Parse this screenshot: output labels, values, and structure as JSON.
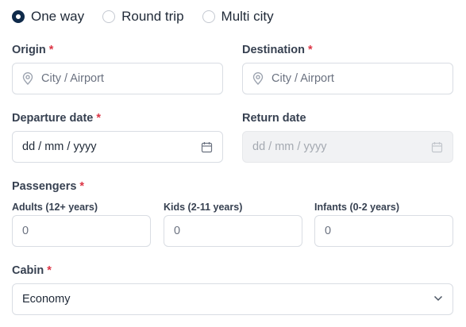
{
  "trip_type": {
    "options": [
      {
        "label": "One way",
        "checked": true
      },
      {
        "label": "Round trip",
        "checked": false
      },
      {
        "label": "Multi city",
        "checked": false
      }
    ]
  },
  "origin": {
    "label": "Origin",
    "required": "*",
    "placeholder": "City / Airport",
    "icon": "map-pin-icon"
  },
  "destination": {
    "label": "Destination",
    "required": "*",
    "placeholder": "City / Airport",
    "icon": "map-pin-icon"
  },
  "departure": {
    "label": "Departure date",
    "required": "*",
    "value": "dd / mm / yyyy",
    "icon": "calendar-icon"
  },
  "return_date": {
    "label": "Return date",
    "placeholder": "dd / mm / yyyy",
    "disabled": true,
    "icon": "calendar-icon"
  },
  "passengers": {
    "label": "Passengers",
    "required": "*",
    "adults": {
      "label": "Adults (12+ years)",
      "value": "0"
    },
    "kids": {
      "label": "Kids (2-11 years)",
      "value": "0"
    },
    "infants": {
      "label": "Infants (0-2 years)",
      "value": "0"
    }
  },
  "cabin": {
    "label": "Cabin",
    "required": "*",
    "value": "Economy",
    "icon": "chevron-down-icon"
  },
  "colors": {
    "accent": "#0f2a4a",
    "required": "#dc3545",
    "border": "#d9dde3",
    "disabled_bg": "#f1f2f4"
  }
}
